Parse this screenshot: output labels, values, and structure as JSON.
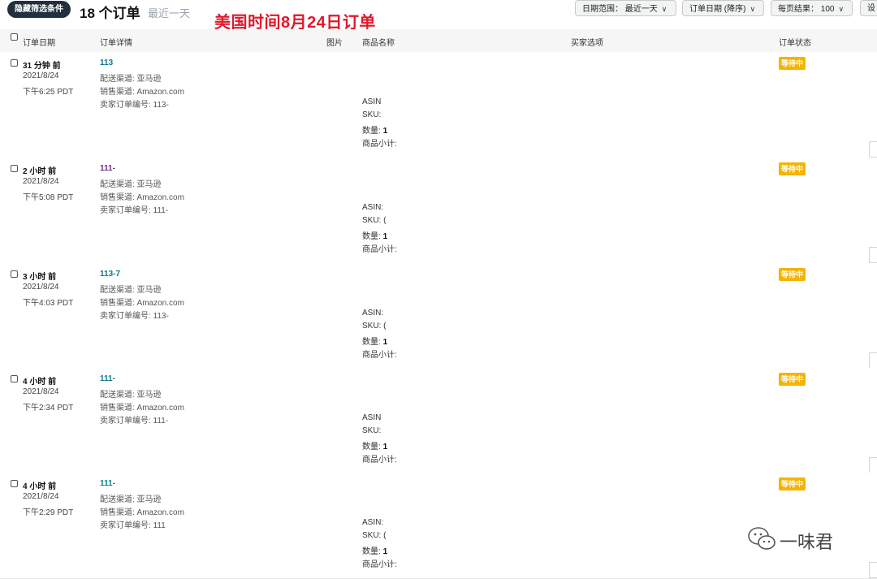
{
  "toolbar": {
    "hide_filters_label": "隐藏筛选条件",
    "order_count": "18 个订单",
    "range_hint": "最近一天",
    "annotation": "美国时间8月24日订单",
    "date_range": "日期范围： 最近一天",
    "sort": "订单日期 (降序)",
    "per_page": "每页结果： 100",
    "settings": "设"
  },
  "table": {
    "headers": {
      "order_date": "订单日期",
      "order_details": "订单详情",
      "image": "图片",
      "product_name": "商品名称",
      "buyer_options": "买家选项",
      "order_status": "订单状态"
    },
    "rows": [
      {
        "ago": "31 分钟 前",
        "date": "2021/8/24",
        "time": "下午6:25 PDT",
        "order_no": "113",
        "shipping": "配送渠道: 亚马逊",
        "channel": "销售渠道: Amazon.com",
        "seller_order": "卖家订单编号: 113-",
        "asin": "ASIN",
        "sku": "SKU:",
        "qty_label": "数量: ",
        "qty": "1",
        "subtotal": "商品小计:",
        "status": "等待中"
      },
      {
        "ago": "2 小时 前",
        "date": "2021/8/24",
        "time": "下午5:08 PDT",
        "order_no": "111-",
        "shipping": "配送渠道: 亚马逊",
        "channel": "销售渠道: Amazon.com",
        "seller_order": "卖家订单编号: 111-",
        "asin": "ASIN:",
        "sku": "SKU: (",
        "qty_label": "数量: ",
        "qty": "1",
        "subtotal": "商品小计:",
        "status": "等待中"
      },
      {
        "ago": "3 小时 前",
        "date": "2021/8/24",
        "time": "下午4:03 PDT",
        "order_no": "113-7",
        "shipping": "配送渠道: 亚马逊",
        "channel": "销售渠道: Amazon.com",
        "seller_order": "卖家订单编号: 113-",
        "asin": "ASIN:",
        "sku": "SKU: (",
        "qty_label": "数量: ",
        "qty": "1",
        "subtotal": "商品小计:",
        "status": "等待中"
      },
      {
        "ago": "4 小时 前",
        "date": "2021/8/24",
        "time": "下午2:34 PDT",
        "order_no": "111-",
        "shipping": "配送渠道: 亚马逊",
        "channel": "销售渠道: Amazon.com",
        "seller_order": "卖家订单编号: 111-",
        "asin": "ASIN",
        "sku": "SKU:",
        "qty_label": "数量: ",
        "qty": "1",
        "subtotal": "商品小计:",
        "status": "等待中"
      },
      {
        "ago": "4 小时 前",
        "date": "2021/8/24",
        "time": "下午2:29 PDT",
        "order_no": "111-",
        "shipping": "配送渠道: 亚马逊",
        "channel": "销售渠道: Amazon.com",
        "seller_order": "卖家订单编号: 111",
        "asin": "ASIN:",
        "sku": "SKU: (",
        "qty_label": "数量: ",
        "qty": "1",
        "subtotal": "商品小计:",
        "status": "等待中"
      }
    ]
  },
  "watermark": {
    "text": "一味君",
    "icon": "wechat-icon"
  },
  "colors": {
    "status_pending": "#f5b400",
    "order_link": "#0f7a8a",
    "order_link_visited": "#6b2a8c",
    "annotation": "#e0172a",
    "filter_button": "#232f3e"
  }
}
